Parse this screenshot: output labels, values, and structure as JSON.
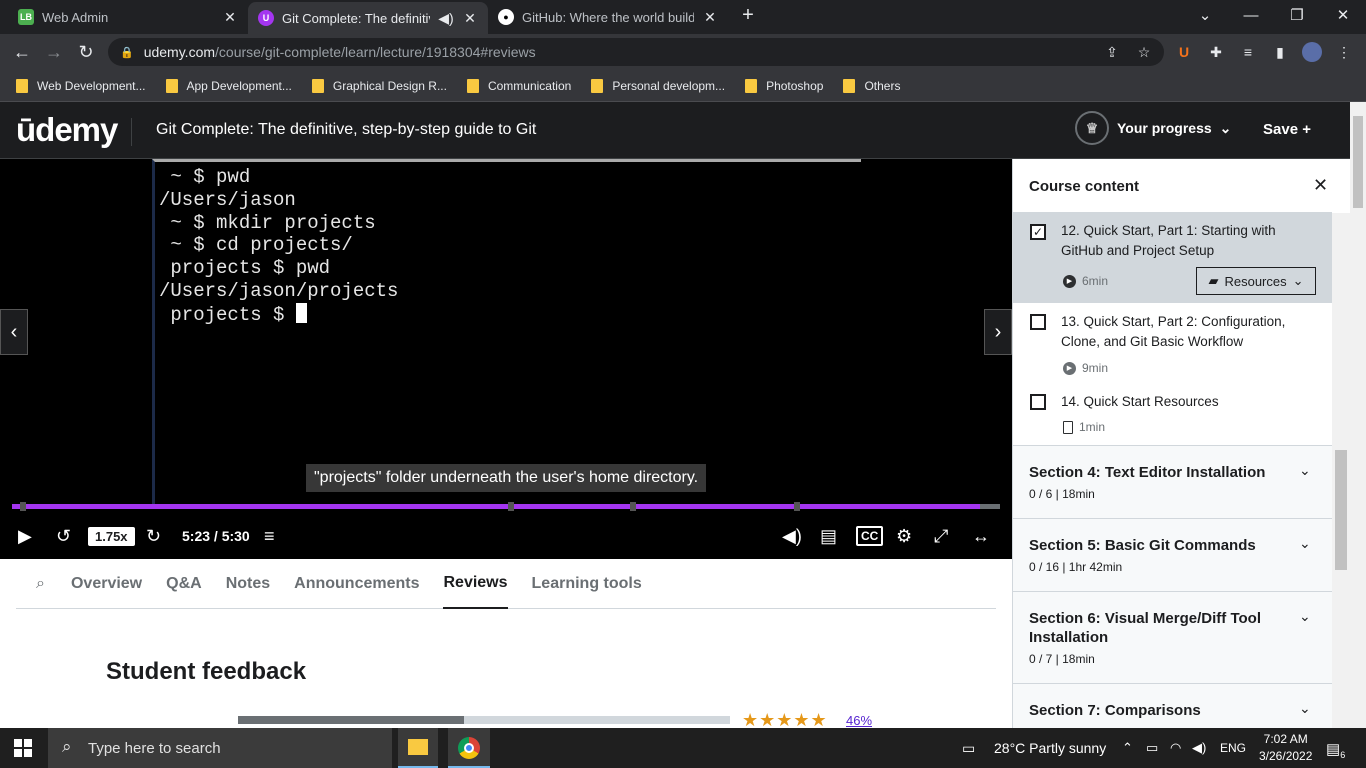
{
  "browser": {
    "tabs": [
      {
        "title": "Web Admin",
        "favicon": "admin-favicon"
      },
      {
        "title": "Git Complete: The definitive,",
        "favicon": "udemy-favicon"
      },
      {
        "title": "GitHub: Where the world builds s",
        "favicon": "github-favicon"
      }
    ],
    "url_host": "udemy.com",
    "url_path": "/course/git-complete/learn/lecture/1918304#reviews",
    "bookmarks": [
      "Web Development...",
      "App Development...",
      "Graphical Design R...",
      "Communication",
      "Personal developm...",
      "Photoshop",
      "Others"
    ]
  },
  "header": {
    "logo": "ūdemy",
    "course_title": "Git Complete: The definitive, step-by-step guide to Git",
    "progress_label": "Your progress",
    "save_label": "Save"
  },
  "video": {
    "terminal_lines": [
      " ~ $ pwd",
      "/Users/jason",
      " ~ $ mkdir projects",
      " ~ $ cd projects/",
      " projects $ pwd",
      "/Users/jason/projects",
      " projects $ "
    ],
    "caption": "\"projects\" folder underneath the user's home directory.",
    "speed": "1.75x",
    "time": "5:23 / 5:30",
    "progress_fraction": 0.98
  },
  "lower_tabs": [
    "Overview",
    "Q&A",
    "Notes",
    "Announcements",
    "Reviews",
    "Learning tools"
  ],
  "selected_tab": "Reviews",
  "reviews": {
    "heading": "Student feedback",
    "rating_row_fraction": 0.46,
    "rating_percent": "46%",
    "stars": 5
  },
  "sidebar": {
    "title": "Course content",
    "lectures": [
      {
        "title": "12. Quick Start, Part 1: Starting with GitHub and Project Setup",
        "duration": "6min",
        "checked": true,
        "resources": "Resources"
      },
      {
        "title": "13. Quick Start, Part 2: Configuration, Clone, and Git Basic Workflow",
        "duration": "9min",
        "checked": false
      },
      {
        "title": "14. Quick Start Resources",
        "duration": "1min",
        "checked": false
      }
    ],
    "sections": [
      {
        "title": "Section 4: Text Editor Installation",
        "meta": "0 / 6 | 18min"
      },
      {
        "title": "Section 5: Basic Git Commands",
        "meta": "0 / 16 | 1hr 42min"
      },
      {
        "title": "Section 6: Visual Merge/Diff Tool Installation",
        "meta": "0 / 7 | 18min"
      },
      {
        "title": "Section 7: Comparisons",
        "meta": ""
      }
    ]
  },
  "taskbar": {
    "search_placeholder": "Type here to search",
    "weather": "28°C  Partly sunny",
    "lang": "ENG",
    "time": "7:02 AM",
    "date": "3/26/2022",
    "notifications": "6"
  },
  "colors": {
    "accent": "#a435f0",
    "dark": "#1c1d1f",
    "star": "#e59819"
  }
}
